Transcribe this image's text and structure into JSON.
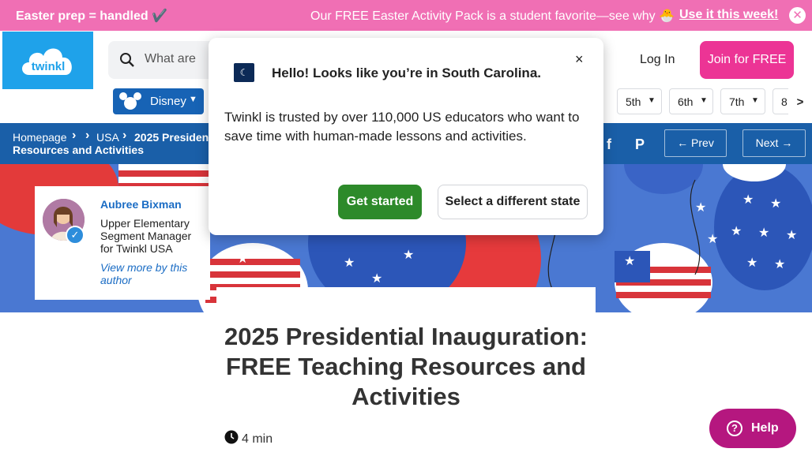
{
  "promo": {
    "left_text": "Easter prep = handled ✔️",
    "middle_text": "Our FREE Easter Activity Pack is a student favorite—see why 🐣",
    "cta": "Use it this week!",
    "close_icon": "close-icon",
    "bg_color": "#f06fb4"
  },
  "header": {
    "logo_text": "twinkl",
    "search_placeholder": "What are",
    "login": "Log In",
    "join": "Join for FREE",
    "join_color": "#ec3495"
  },
  "nav": {
    "disney": "Disney",
    "grades": [
      "5th",
      "6th",
      "7th",
      "8"
    ],
    "scroll_right": ">"
  },
  "breadcrumb": {
    "items": [
      "Homepage",
      "USA"
    ],
    "current": "2025 Presidential Inauguration: FREE Teaching Resources and Activities",
    "current_visible": "2025 Presiden… Resources and Activities",
    "prev": "Prev",
    "next": "Next",
    "bar_color": "#1a5fa8"
  },
  "author": {
    "name": "Aubree Bixman",
    "role": "Upper Elementary Segment Manager for Twinkl USA",
    "more": "View more by this author"
  },
  "article": {
    "title": "2025 Presidential Inauguration: FREE Teaching Resources and Activities",
    "read_time": "4 min"
  },
  "help": {
    "label": "Help"
  },
  "modal": {
    "title": "Hello! Looks like you’re in South Carolina.",
    "body": "Twinkl is trusted by over 110,000 US educators who want to save time with human-made lessons and activities.",
    "primary": "Get started",
    "secondary": "Select a different state",
    "close": "×",
    "primary_color": "#2d8a2a"
  }
}
